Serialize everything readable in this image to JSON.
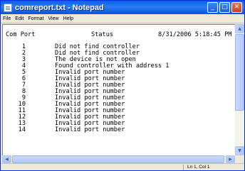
{
  "window": {
    "title": "comreport.txt - Notepad",
    "buttons": {
      "minimize": "_",
      "maximize": "□",
      "close": "✕"
    }
  },
  "menu": [
    "File",
    "Edit",
    "Format",
    "View",
    "Help"
  ],
  "document": {
    "header_port": "Com Port",
    "header_status": "Status",
    "header_timestamp": "8/31/2006 5:18:45 PM",
    "rows": [
      {
        "port": "1",
        "status": "Did not find controller"
      },
      {
        "port": "2",
        "status": "Did not find controller"
      },
      {
        "port": "3",
        "status": "The device is not open"
      },
      {
        "port": "4",
        "status": "Found controller with address 1"
      },
      {
        "port": "5",
        "status": "Invalid port number"
      },
      {
        "port": "6",
        "status": "Invalid port number"
      },
      {
        "port": "7",
        "status": "Invalid port number"
      },
      {
        "port": "8",
        "status": "Invalid port number"
      },
      {
        "port": "9",
        "status": "Invalid port number"
      },
      {
        "port": "10",
        "status": "Invalid port number"
      },
      {
        "port": "11",
        "status": "Invalid port number"
      },
      {
        "port": "12",
        "status": "Invalid port number"
      },
      {
        "port": "13",
        "status": "Invalid port number"
      },
      {
        "port": "14",
        "status": "Invalid port number"
      }
    ]
  },
  "statusbar": {
    "position": "Ln 1, Col 1"
  },
  "scroll_glyphs": {
    "up": "▲",
    "down": "▼",
    "left": "◀",
    "right": "▶"
  },
  "colors": {
    "titlebar": "#0a5ee8",
    "window_face": "#ece9d8",
    "editor_bg": "#ffffff"
  }
}
